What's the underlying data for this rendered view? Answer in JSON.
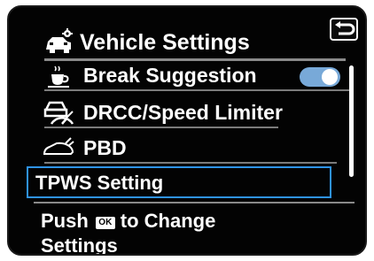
{
  "header": {
    "title": "Vehicle Settings",
    "icon": "car-gear-icon",
    "back_icon": "back-icon"
  },
  "menu": {
    "items": [
      {
        "label": "Break Suggestion",
        "icon": "coffee-cup-icon",
        "toggle": true,
        "toggle_on": true
      },
      {
        "label": "DRCC/Speed Limiter",
        "icon": "car-speed-icon"
      },
      {
        "label": "PBD",
        "icon": "car-outline-icon"
      },
      {
        "label": "TPWS Setting",
        "selected": true
      }
    ]
  },
  "footer": {
    "line1_prefix": "Push",
    "ok_badge": "OK",
    "line1_suffix": "to Change",
    "line2": "Settings"
  },
  "colors": {
    "background": "#030303",
    "text": "#ffffff",
    "accent": "#2f93e9",
    "toggle_on": "#78a9d8",
    "divider": "#8a8a8a"
  }
}
